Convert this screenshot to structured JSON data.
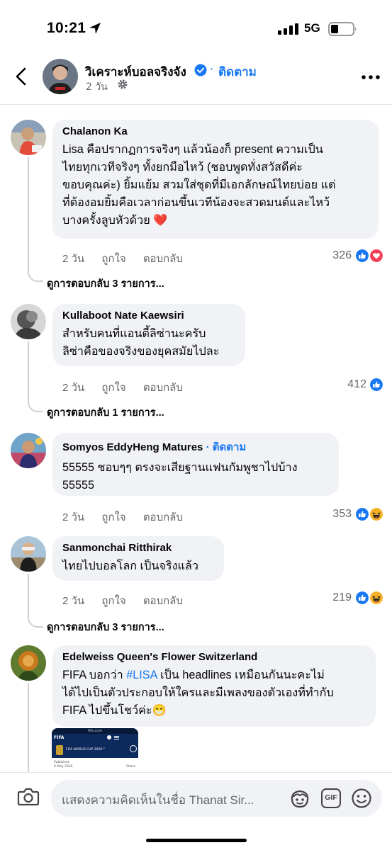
{
  "status_bar": {
    "time": "10:21",
    "network": "5G"
  },
  "header": {
    "page_name": "วิเคราะห์บอลจริงจัง",
    "follow_label": "ติดตาม",
    "separator": "·",
    "post_time": "2 วัน"
  },
  "actions": {
    "like": "ถูกใจ",
    "reply": "ตอบกลับ"
  },
  "comments": [
    {
      "author": "Chalanon Ka",
      "text": "Lisa คือปรากฏการจริงๆ แล้วน้องก็ present ความเป็น\nไทยทุกเวทีจริงๆ ทั้งยกมือไหว้ (ชอบพูดทั่งสวัสดีค่ะ\nขอบคุณค่ะ) ยิ้มแย้ม สวมใส่ชุดที่มีเอกลักษณ์ไทยบ่อย แต่\nที่ต้องอมยิ้มคือเวลาก่อนขึ้นเวทีน้องจะสวดมนต์และไหว้\nบางครั้งลูบหัวด้วย ❤️",
      "time": "2 วัน",
      "reaction_count": "326",
      "replies": "ดูการตอบกลับ 3 รายการ..."
    },
    {
      "author": "Kullaboot Nate Kaewsiri",
      "text": "สำหรับคนที่แอนตี้ลิซ่านะครับ\nลิซ่าคือของจริงของยุคสมัยไปละ",
      "time": "2 วัน",
      "reaction_count": "412",
      "replies": "ดูการตอบกลับ 1 รายการ..."
    },
    {
      "author": "Somyos EddyHeng Matures",
      "follow": "ติดตาม",
      "separator": "·",
      "text": "55555 ชอบๆๆ ตรงจะเสียฐานแฟนกัมพูชาไปบ้าง\n55555",
      "time": "2 วัน",
      "reaction_count": "353"
    },
    {
      "author": "Sanmonchai Ritthirak",
      "text": "ไทยไปบอลโลก เป็นจริงแล้ว",
      "time": "2 วัน",
      "reaction_count": "219",
      "replies": "ดูการตอบกลับ 3 รายการ..."
    },
    {
      "author": "Edelweiss Queen's Flower Switzerland",
      "text_part1": "FIFA บอกว่า ",
      "hashtag": "#LISA",
      "text_part2": " เป็น headlines เหมือนกันนะคะไม่\nได้ไปเป็นตัวประกอบให้ใครและมีเพลงของตัวเองที่ทำกับ\nFIFA ไปขึ้นโชว์ค่ะ😁"
    }
  ],
  "link_preview": {
    "site": "fifa.com",
    "brand": "FIFA",
    "headline": "FIFA WORLD CUP 2026™",
    "label": "Published",
    "date": "9 May 2026",
    "share": "Share"
  },
  "composer": {
    "placeholder": "แสดงความคิดเห็นในชื่อ Thanat Sir...",
    "gif_label": "GIF"
  },
  "colors": {
    "accent": "#1877f2",
    "bubble": "#f0f2f5",
    "secondary_text": "#65676b",
    "love": "#f33e58",
    "haha": "#f7b125"
  },
  "icons": [
    "back-arrow-icon",
    "verified-badge-icon",
    "gear-icon",
    "more-icon",
    "like-reaction-icon",
    "love-reaction-icon",
    "haha-reaction-icon",
    "camera-icon",
    "avatar-sticker-icon",
    "gif-icon",
    "emoji-icon"
  ]
}
